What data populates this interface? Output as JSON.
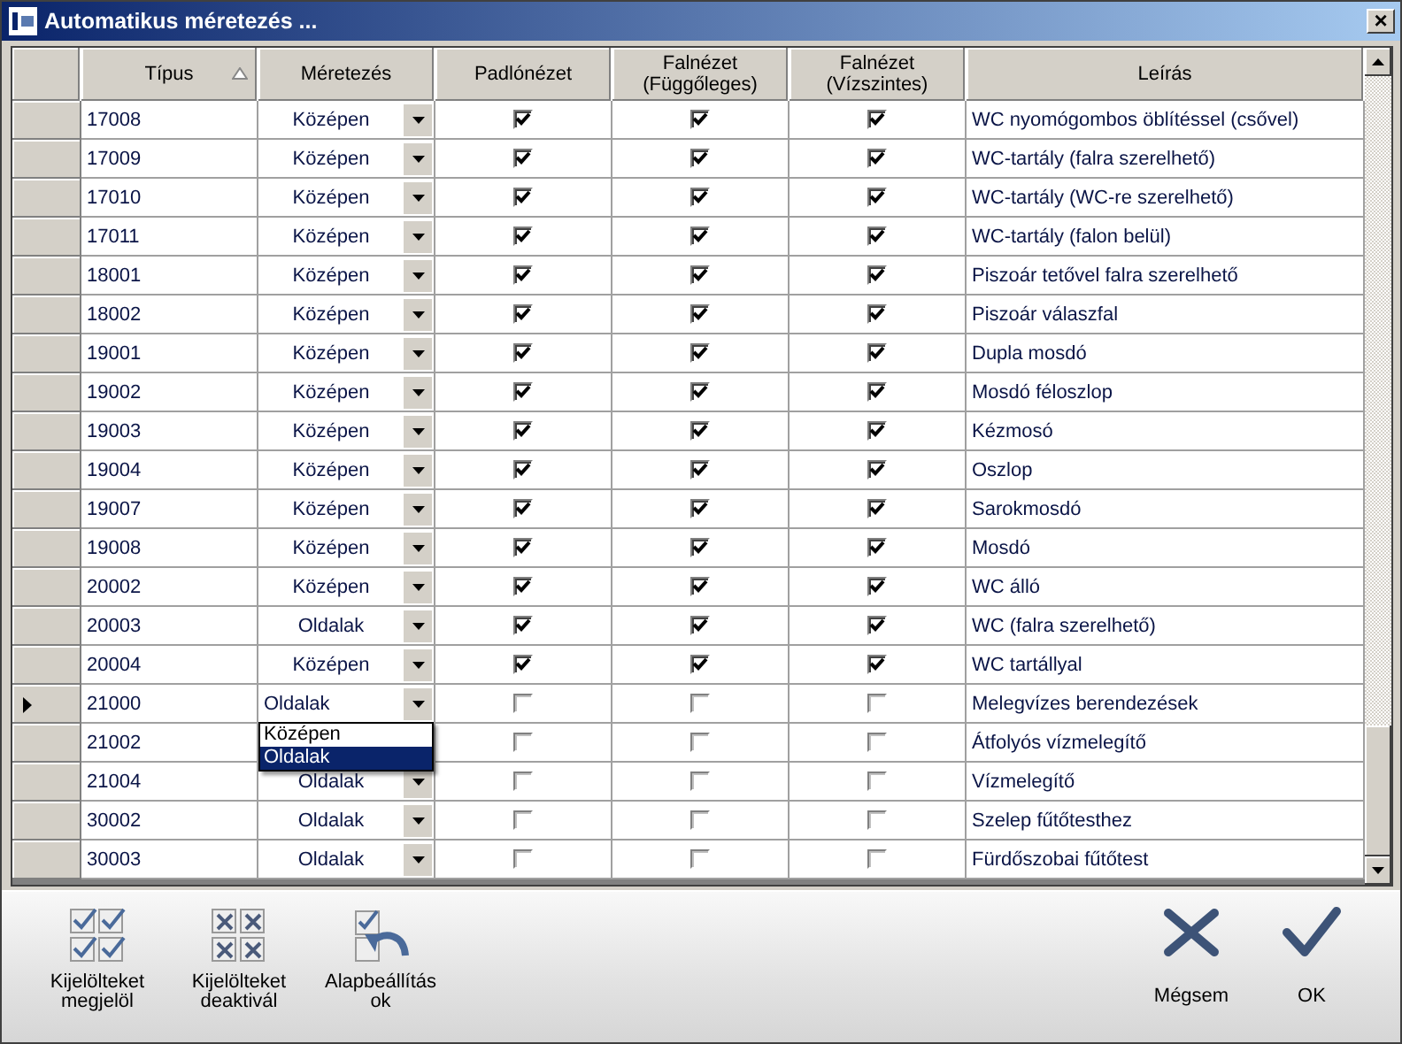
{
  "window": {
    "title": "Automatikus méretezés ...",
    "close": "×"
  },
  "table": {
    "columns": [
      {
        "label": "Típus",
        "sorted": true
      },
      {
        "label": "Méretezés",
        "sorted": false
      },
      {
        "label": "Padlónézet",
        "sorted": false
      },
      {
        "label": "Falnézet\n(Függőleges)",
        "sorted": false
      },
      {
        "label": "Falnézet\n(Vízszintes)",
        "sorted": false
      },
      {
        "label": "Leírás",
        "sorted": false
      }
    ],
    "rows": [
      {
        "type": "17008",
        "sizing": "Középen",
        "floor": true,
        "wall_v": true,
        "wall_h": true,
        "description": "WC nyomógombos öblítéssel (csővel)",
        "current": false
      },
      {
        "type": "17009",
        "sizing": "Középen",
        "floor": true,
        "wall_v": true,
        "wall_h": true,
        "description": "WC-tartály (falra szerelhető)",
        "current": false
      },
      {
        "type": "17010",
        "sizing": "Középen",
        "floor": true,
        "wall_v": true,
        "wall_h": true,
        "description": "WC-tartály (WC-re szerelhető)",
        "current": false
      },
      {
        "type": "17011",
        "sizing": "Középen",
        "floor": true,
        "wall_v": true,
        "wall_h": true,
        "description": "WC-tartály (falon belül)",
        "current": false
      },
      {
        "type": "18001",
        "sizing": "Középen",
        "floor": true,
        "wall_v": true,
        "wall_h": true,
        "description": "Piszoár tetővel falra szerelhető",
        "current": false
      },
      {
        "type": "18002",
        "sizing": "Középen",
        "floor": true,
        "wall_v": true,
        "wall_h": true,
        "description": "Piszoár válaszfal",
        "current": false
      },
      {
        "type": "19001",
        "sizing": "Középen",
        "floor": true,
        "wall_v": true,
        "wall_h": true,
        "description": "Dupla mosdó",
        "current": false
      },
      {
        "type": "19002",
        "sizing": "Középen",
        "floor": true,
        "wall_v": true,
        "wall_h": true,
        "description": "Mosdó féloszlop",
        "current": false
      },
      {
        "type": "19003",
        "sizing": "Középen",
        "floor": true,
        "wall_v": true,
        "wall_h": true,
        "description": "Kézmosó",
        "current": false
      },
      {
        "type": "19004",
        "sizing": "Középen",
        "floor": true,
        "wall_v": true,
        "wall_h": true,
        "description": "Oszlop",
        "current": false
      },
      {
        "type": "19007",
        "sizing": "Középen",
        "floor": true,
        "wall_v": true,
        "wall_h": true,
        "description": "Sarokmosdó",
        "current": false
      },
      {
        "type": "19008",
        "sizing": "Középen",
        "floor": true,
        "wall_v": true,
        "wall_h": true,
        "description": "Mosdó",
        "current": false
      },
      {
        "type": "20002",
        "sizing": "Középen",
        "floor": true,
        "wall_v": true,
        "wall_h": true,
        "description": "WC álló",
        "current": false
      },
      {
        "type": "20003",
        "sizing": "Oldalak",
        "floor": true,
        "wall_v": true,
        "wall_h": true,
        "description": "WC (falra szerelhető)",
        "current": false
      },
      {
        "type": "20004",
        "sizing": "Középen",
        "floor": true,
        "wall_v": true,
        "wall_h": true,
        "description": "WC tartállyal",
        "current": false
      },
      {
        "type": "21000",
        "sizing": "Oldalak",
        "floor": false,
        "wall_v": false,
        "wall_h": false,
        "description": "Melegvízes berendezések",
        "current": true,
        "dropdown": [
          {
            "label": "Középen",
            "selected": false
          },
          {
            "label": "Oldalak",
            "selected": true
          }
        ]
      },
      {
        "type": "21002",
        "floor": false,
        "wall_v": false,
        "wall_h": false,
        "description": "Átfolyós vízmelegítő",
        "current": false
      },
      {
        "type": "21004",
        "sizing": "Oldalak",
        "floor": false,
        "wall_v": false,
        "wall_h": false,
        "description": "Vízmelegítő",
        "current": false
      },
      {
        "type": "30002",
        "sizing": "Oldalak",
        "floor": false,
        "wall_v": false,
        "wall_h": false,
        "description": "Szelep fűtőtesthez",
        "current": false
      },
      {
        "type": "30003",
        "sizing": "Oldalak",
        "floor": false,
        "wall_v": false,
        "wall_h": false,
        "description": "Fürdőszobai fűtőtest",
        "current": false
      }
    ]
  },
  "toolbar": {
    "left": [
      {
        "kind": "check-all",
        "label": "Kijelölteket\nmegjelöl"
      },
      {
        "kind": "uncheck-all",
        "label": "Kijelölteket\ndeaktivál"
      },
      {
        "kind": "reset",
        "label": "Alapbeállítás\nok"
      }
    ],
    "right": [
      {
        "kind": "cancel",
        "label": "Mégsem"
      },
      {
        "kind": "ok",
        "label": "OK"
      }
    ]
  }
}
